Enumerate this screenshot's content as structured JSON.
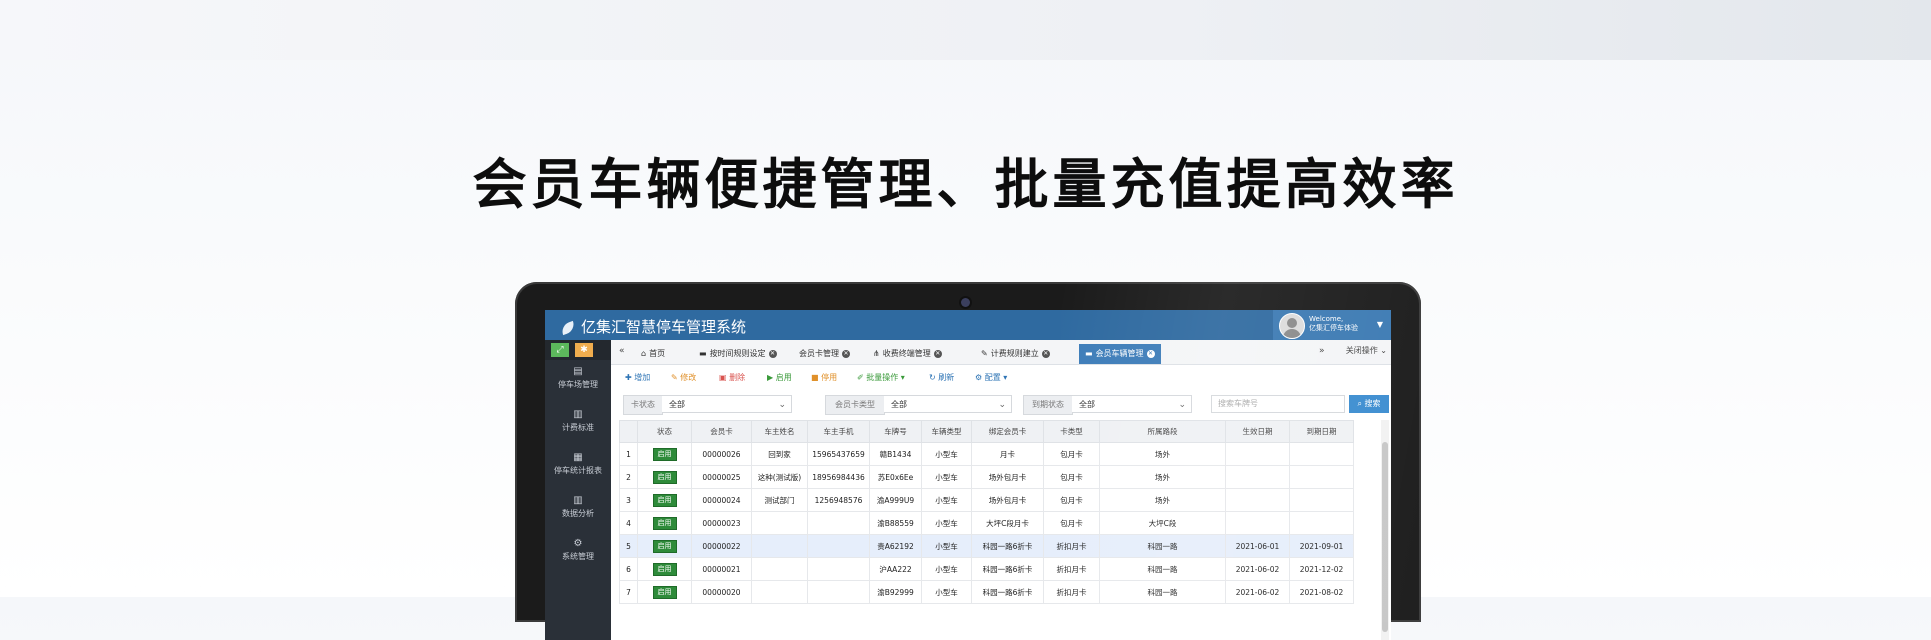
{
  "headline": "会员车辆便捷管理、批量充值提高效率",
  "app": {
    "title": "亿集汇智慧停车管理系统",
    "user": {
      "welcome": "Welcome,",
      "name": "亿集汇停车体验"
    }
  },
  "sidebar": {
    "items": [
      {
        "label": "停车场管理",
        "icon": "database-icon"
      },
      {
        "label": "计费标准",
        "icon": "bar-chart-icon"
      },
      {
        "label": "停车统计报表",
        "icon": "calculator-icon"
      },
      {
        "label": "数据分析",
        "icon": "bar-chart-icon"
      },
      {
        "label": "系统管理",
        "icon": "gears-icon"
      }
    ]
  },
  "tabs": {
    "items": [
      "首页",
      "按时间规则设定",
      "会员卡管理",
      "收费终端管理",
      "计费规则建立",
      "会员车辆管理"
    ],
    "close_ops": "关闭操作"
  },
  "toolbar": {
    "items": [
      "增加",
      "修改",
      "删除",
      "启用",
      "停用",
      "批量操作",
      "刷新",
      "配置"
    ]
  },
  "filters": {
    "card_status": {
      "label": "卡状态",
      "value": "全部"
    },
    "card_type": {
      "label": "会员卡类型",
      "value": "全部"
    },
    "expire_status": {
      "label": "到期状态",
      "value": "全部"
    },
    "search_placeholder": "搜索车牌号",
    "search_button": "搜索"
  },
  "table": {
    "columns": [
      "",
      "状态",
      "会员卡",
      "车主姓名",
      "车主手机",
      "车牌号",
      "车辆类型",
      "绑定会员卡",
      "卡类型",
      "所属路段",
      "生效日期",
      "到期日期"
    ],
    "rows": [
      [
        "1",
        "启用",
        "00000026",
        "回到家",
        "15965437659",
        "赣B1434",
        "小型车",
        "月卡",
        "包月卡",
        "场外",
        "",
        ""
      ],
      [
        "2",
        "启用",
        "00000025",
        "这种(测试版)",
        "18956984436",
        "苏E0x6Ee",
        "小型车",
        "场外包月卡",
        "包月卡",
        "场外",
        "",
        ""
      ],
      [
        "3",
        "启用",
        "00000024",
        "测试部门",
        "1256948576",
        "渝A999U9",
        "小型车",
        "场外包月卡",
        "包月卡",
        "场外",
        "",
        ""
      ],
      [
        "4",
        "启用",
        "00000023",
        "",
        "",
        "渝B88559",
        "小型车",
        "大坪C段月卡",
        "包月卡",
        "大坪C段",
        "",
        ""
      ],
      [
        "5",
        "启用",
        "00000022",
        "",
        "",
        "贵A62192",
        "小型车",
        "科园一路6折卡",
        "折扣月卡",
        "科园一路",
        "2021-06-01",
        "2021-09-01"
      ],
      [
        "6",
        "启用",
        "00000021",
        "",
        "",
        "沪AA222",
        "小型车",
        "科园一路6折卡",
        "折扣月卡",
        "科园一路",
        "2021-06-02",
        "2021-12-02"
      ],
      [
        "7",
        "启用",
        "00000020",
        "",
        "",
        "渝B92999",
        "小型车",
        "科园一路6折卡",
        "折扣月卡",
        "科园一路",
        "2021-06-02",
        "2021-08-02"
      ]
    ],
    "highlighted_row": 5
  },
  "colors": {
    "header": "#2f6aa0",
    "sidebar": "#2a3038",
    "active_tab": "#3e7db9",
    "badge": "#2e8b3a",
    "search_button": "#3c8dd0"
  }
}
